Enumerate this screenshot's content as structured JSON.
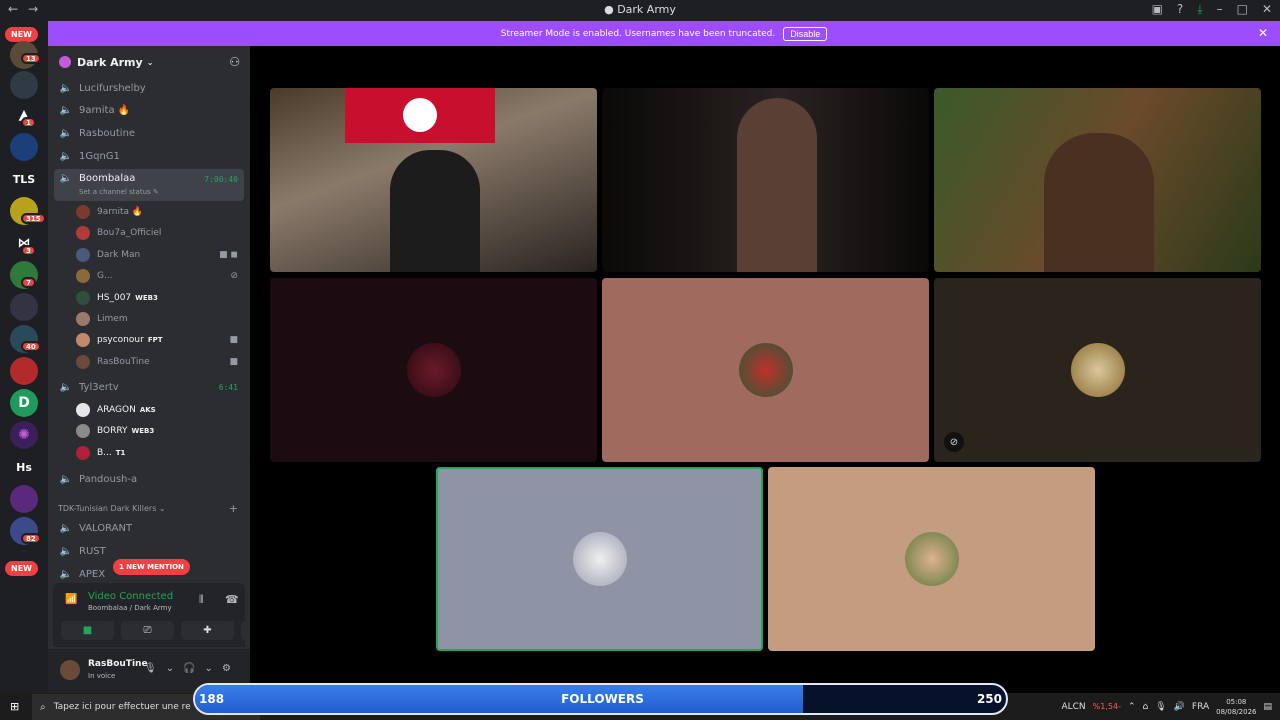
{
  "titlebar": {
    "title": "Dark Army",
    "back": "←",
    "forward": "→"
  },
  "rail": {
    "new_top": "NEW",
    "new_bottom": "NEW",
    "tls": "TLS",
    "hs": "Hs",
    "badges": [
      "13",
      "1",
      "315",
      "3",
      "7",
      "40",
      "82"
    ]
  },
  "banner": {
    "text": "Streamer Mode is enabled. Usernames have been truncated.",
    "button": "Disable"
  },
  "guild": {
    "name": "Dark Army"
  },
  "channels": {
    "c1": "Lucifurshelby",
    "c2": "9arnita 🔥",
    "c3": "Rasboutine",
    "c4": "1GqnG1",
    "active": {
      "name": "Boombalaa",
      "timer": "7:00:40",
      "status": "Set a channel status ✎"
    },
    "tyl": {
      "name": "Tyl3ertv",
      "timer": "6:41"
    },
    "pandoush": "Pandoush-a",
    "category": "TDK-Tunisian Dark Killers",
    "valorant": "VALORANT",
    "rust": "RUST",
    "apex": "APEX",
    "mention": "1 NEW MENTION"
  },
  "members_boombalaa": [
    {
      "name": "9arnita 🔥",
      "color": "#7a3b2e"
    },
    {
      "name": "Bou7a_Officiel",
      "color": "#b23a3a"
    },
    {
      "name": "Dark Man",
      "color": "#4a5a7a"
    },
    {
      "name": "G...",
      "color": "#8a6a3a"
    },
    {
      "name": "HS_007",
      "tag": "WEB3",
      "color": "#2f4f3f"
    },
    {
      "name": "Limem",
      "color": "#9a7a6a"
    },
    {
      "name": "psyconour",
      "tag": "FPT",
      "color": "#c08a6a"
    },
    {
      "name": "RasBouTine",
      "color": "#6b4a3a"
    }
  ],
  "members_tyl": [
    {
      "name": "ARAGON",
      "tag": "AKS",
      "color": "#e6e6e6"
    },
    {
      "name": "BORRY",
      "tag": "WEB3",
      "color": "#8a8a8a"
    },
    {
      "name": "B...",
      "tag": "T1",
      "color": "#b0203a"
    }
  ],
  "voice": {
    "title": "Video Connected",
    "sub": "Boombalaa / Dark Army"
  },
  "user": {
    "name": "RasBouTine",
    "status": "In voice"
  },
  "taskbar": {
    "search": "Tapez ici pour effectuer une re",
    "ticker": "ALCN",
    "ticker_change": "%1,54-",
    "lang": "FRA",
    "time": "05:08",
    "date": "08/08/2026"
  },
  "followers": {
    "label": "FOLLOWERS",
    "current": "188",
    "goal": "250",
    "progress": 0.75
  },
  "colors": {
    "accent_live": "#23a55a",
    "banner": "#9b4dff",
    "mention": "#f23f43"
  }
}
